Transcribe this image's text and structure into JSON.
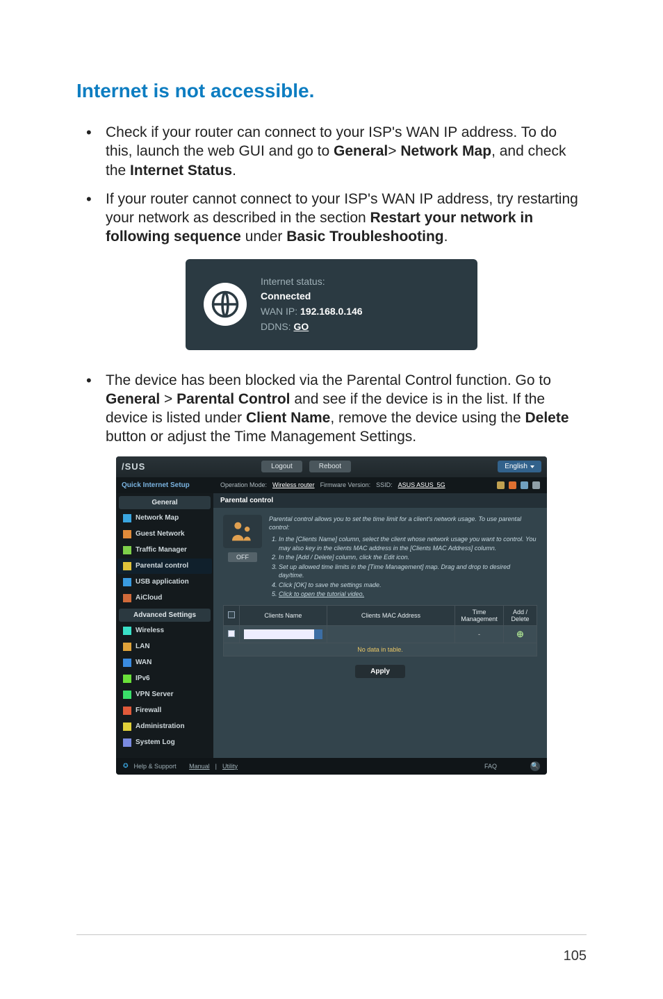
{
  "heading": "Internet is not accessible.",
  "bullets": {
    "b1_pre": "Check if your router can connect to your ISP's WAN IP address. To do this, launch the web GUI and go to ",
    "b1_bold1": "General",
    "b1_gt": "> ",
    "b1_bold2": "Network Map",
    "b1_mid": ", and check the ",
    "b1_bold3": "Internet Status",
    "b1_end": ".",
    "b2_pre": "If your router cannot connect to your ISP's WAN IP address, try restarting your network as described in the section ",
    "b2_bold1": "Restart your network in following sequence",
    "b2_mid": " under ",
    "b2_bold2": "Basic Troubleshooting",
    "b2_end": ".",
    "b3_pre": "The device has been blocked via the Parental Control function. Go to ",
    "b3_bold1": "General",
    "b3_gt": " > ",
    "b3_bold2": "Parental Control",
    "b3_mid1": " and see if the device is in the list. If the device is listed under ",
    "b3_bold3": "Client Name",
    "b3_mid2": ", remove the device using the ",
    "b3_bold4": "Delete",
    "b3_end": " button or adjust the Time Management Settings."
  },
  "status": {
    "line1": "Internet status:",
    "connected": "Connected",
    "wan_label": "WAN IP: ",
    "wan_ip": "192.168.0.146",
    "ddns_label": "DDNS: ",
    "ddns_link": "GO"
  },
  "gui": {
    "brand": "/SUS",
    "logout": "Logout",
    "reboot": "Reboot",
    "lang": "English",
    "opmode_label": "Operation Mode: ",
    "opmode_value": "Wireless router",
    "fw_label": "   Firmware Version:",
    "ssid_label": "   SSID: ",
    "ssid_value": "ASUS ASUS_5G",
    "qis": "Quick Internet Setup",
    "group_general": "General",
    "group_advanced": "Advanced Settings",
    "nav": {
      "network_map": "Network Map",
      "guest": "Guest Network",
      "traffic": "Traffic Manager",
      "parental": "Parental control",
      "usb": "USB application",
      "aicloud": "AiCloud",
      "wireless": "Wireless",
      "lan": "LAN",
      "wan": "WAN",
      "ipv6": "IPv6",
      "vpn": "VPN Server",
      "firewall": "Firewall",
      "admin": "Administration",
      "syslog": "System Log"
    },
    "tab": "Parental control",
    "intro": "Parental control allows you to set the time limit for a client's network usage. To use parental control:",
    "steps": {
      "s1": "In the [Clients Name] column, select the client whose network usage you want to control. You may also key in the clients MAC address in the [Clients MAC Address] column.",
      "s2": "In the [Add / Delete] column, click the Edit icon.",
      "s3": "Set up allowed time limits in the [Time Management] map. Drag and drop to desired day/time.",
      "s4": "Click [OK] to save the settings made.",
      "s5": "Click to open the tutorial video."
    },
    "off": "OFF",
    "table": {
      "h1": "",
      "h2": "Clients Name",
      "h3": "Clients MAC Address",
      "h4": "Time Management",
      "h5": "Add / Delete",
      "dash": "-",
      "nodata": "No data in table."
    },
    "apply": "Apply",
    "footer": {
      "help": "Help & Support",
      "manual": "Manual",
      "sep": " | ",
      "utility": "Utility",
      "faq": "FAQ"
    }
  },
  "page_number": "105"
}
